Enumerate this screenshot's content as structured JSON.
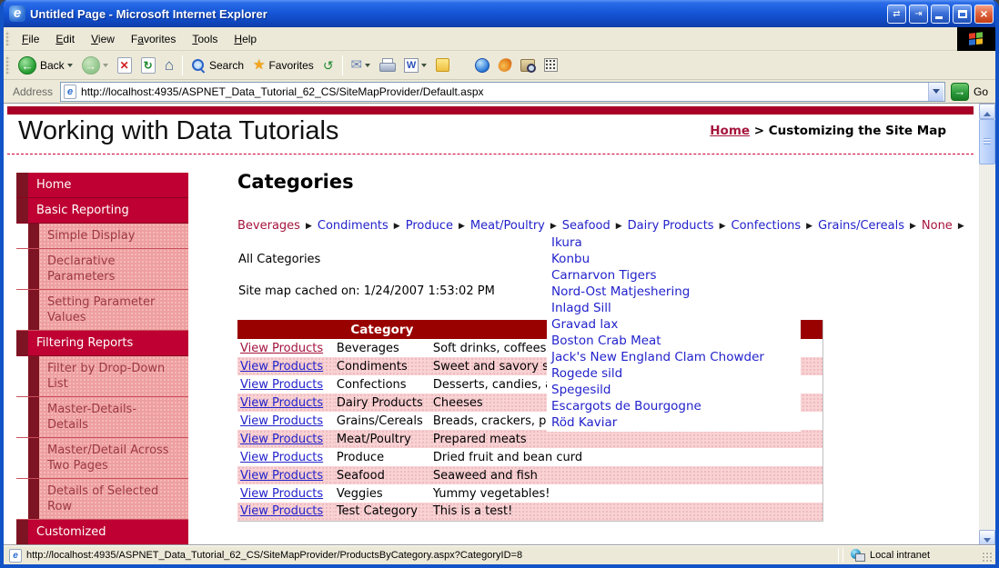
{
  "colors": {
    "crimson": "#be0032",
    "dark_maroon": "#7d1423",
    "sidebar_pink": "#ee9f9f",
    "table_header_red": "#990000",
    "table_pink": "#f9d2d4",
    "link_blue": "#2222cc",
    "link_red": "#a5143c",
    "top_bar_red": "#a80026",
    "chrome_beige": "#ECE9D8",
    "titlebar_blue": "#1557d6"
  },
  "window": {
    "title": "Untitled Page - Microsoft Internet Explorer",
    "menu": [
      {
        "label": "File",
        "u": 0
      },
      {
        "label": "Edit",
        "u": 0
      },
      {
        "label": "View",
        "u": 0
      },
      {
        "label": "Favorites",
        "u": 1
      },
      {
        "label": "Tools",
        "u": 0
      },
      {
        "label": "Help",
        "u": 0
      }
    ],
    "toolbar": {
      "back_label": "Back",
      "search_label": "Search",
      "favorites_label": "Favorites"
    },
    "address": {
      "label": "Address",
      "url": "http://localhost:4935/ASPNET_Data_Tutorial_62_CS/SiteMapProvider/Default.aspx",
      "go_label": "Go"
    },
    "status": {
      "url": "http://localhost:4935/ASPNET_Data_Tutorial_62_CS/SiteMapProvider/ProductsByCategory.aspx?CategoryID=8",
      "zone": "Local intranet"
    }
  },
  "page": {
    "site_title": "Working with Data Tutorials",
    "breadcrumb": {
      "home": "Home",
      "separator": ">",
      "current": "Customizing the Site Map"
    },
    "sidebar": [
      {
        "label": "Home",
        "level": 1
      },
      {
        "label": "Basic Reporting",
        "level": 1
      },
      {
        "label": "Simple Display",
        "level": 2
      },
      {
        "label": "Declarative Parameters",
        "level": 2
      },
      {
        "label": "Setting Parameter Values",
        "level": 2
      },
      {
        "label": "Filtering Reports",
        "level": 1
      },
      {
        "label": "Filter by Drop-Down List",
        "level": 2
      },
      {
        "label": "Master-Details-Details",
        "level": 2
      },
      {
        "label": "Master/Detail Across Two Pages",
        "level": 2
      },
      {
        "label": "Details of Selected Row",
        "level": 2
      },
      {
        "label": "Customized",
        "level": 1
      }
    ],
    "heading": "Categories",
    "category_menu": {
      "separator": "▶",
      "items": [
        {
          "label": "Beverages",
          "hot": true
        },
        {
          "label": "Condiments",
          "hot": false
        },
        {
          "label": "Produce",
          "hot": false
        },
        {
          "label": "Meat/Poultry",
          "hot": false
        },
        {
          "label": "Seafood",
          "hot": false
        },
        {
          "label": "Dairy Products",
          "hot": false
        },
        {
          "label": "Confections",
          "hot": false
        },
        {
          "label": "Grains/Cereals",
          "hot": false
        },
        {
          "label": "None",
          "hot": true
        }
      ]
    },
    "all_categories": "All Categories",
    "cache_note": "Site map cached on: 1/24/2007 1:53:02 PM",
    "table": {
      "headers": [
        "",
        "Category",
        ""
      ],
      "action_label": "View Products",
      "rows": [
        {
          "category": "Beverages",
          "description": "Soft drinks, coffees, teas, beers, and ales",
          "visited": true
        },
        {
          "category": "Condiments",
          "description": "Sweet and savory sauces, relishes, spreads, and seasonings",
          "visited": false
        },
        {
          "category": "Confections",
          "description": "Desserts, candies, and sweet breads",
          "visited": false
        },
        {
          "category": "Dairy Products",
          "description": "Cheeses",
          "visited": false
        },
        {
          "category": "Grains/Cereals",
          "description": "Breads, crackers, pasta, and cereal",
          "visited": false
        },
        {
          "category": "Meat/Poultry",
          "description": "Prepared meats",
          "visited": false
        },
        {
          "category": "Produce",
          "description": "Dried fruit and bean curd",
          "visited": false
        },
        {
          "category": "Seafood",
          "description": "Seaweed and fish",
          "visited": false
        },
        {
          "category": "Veggies",
          "description": "Yummy vegetables!",
          "visited": false
        },
        {
          "category": "Test Category",
          "description": "This is a test!",
          "visited": false
        }
      ]
    },
    "flyout_items": [
      "Ikura",
      "Konbu",
      "Carnarvon Tigers",
      "Nord-Ost Matjeshering",
      "Inlagd Sill",
      "Gravad lax",
      "Boston Crab Meat",
      "Jack's New England Clam Chowder",
      "Rogede sild",
      "Spegesild",
      "Escargots de Bourgogne",
      "Röd Kaviar"
    ]
  }
}
